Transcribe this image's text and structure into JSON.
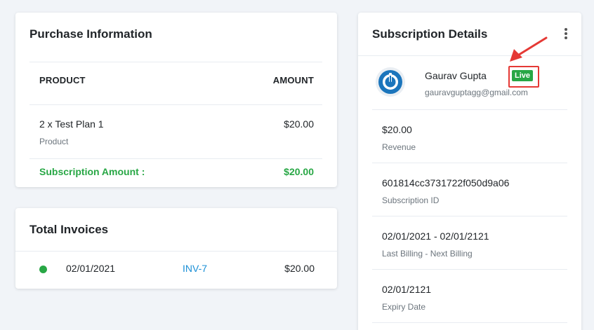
{
  "purchase": {
    "title": "Purchase Information",
    "columns": {
      "product": "PRODUCT",
      "amount": "AMOUNT"
    },
    "items": [
      {
        "name": "2 x Test Plan 1",
        "type": "Product",
        "amount": "$20.00"
      }
    ],
    "total": {
      "label": "Subscription Amount :",
      "value": "$20.00"
    }
  },
  "invoices": {
    "title": "Total Invoices",
    "rows": [
      {
        "date": "02/01/2021",
        "number": "INV-7",
        "amount": "$20.00"
      }
    ]
  },
  "subscription": {
    "title": "Subscription Details",
    "menu_icon": "kebab-menu-icon",
    "user": {
      "name": "Gaurav Gupta",
      "status": "Live",
      "email": "gauravguptagg@gmail.com",
      "avatar_icon": "power-icon"
    },
    "details": [
      {
        "value": "$20.00",
        "label": "Revenue"
      },
      {
        "value": "601814cc3731722f050d9a06",
        "label": "Subscription ID"
      },
      {
        "value": "02/01/2021 - 02/01/2121",
        "label": "Last Billing - Next Billing"
      },
      {
        "value": "02/01/2121",
        "label": "Expiry Date"
      }
    ]
  },
  "colors": {
    "success": "#28a745",
    "link": "#1a8fd6",
    "highlight": "#e53935",
    "avatar": "#1b75bc"
  }
}
